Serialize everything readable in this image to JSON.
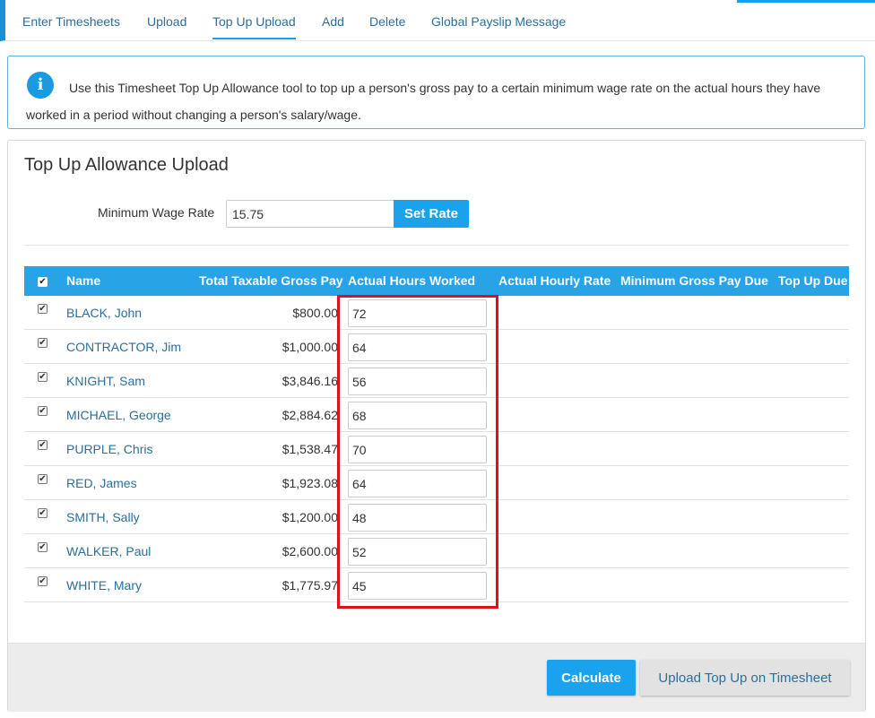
{
  "nav": {
    "tabs": [
      {
        "label": "Enter Timesheets"
      },
      {
        "label": "Upload"
      },
      {
        "label": "Top Up Upload",
        "active": true
      },
      {
        "label": "Add"
      },
      {
        "label": "Delete"
      },
      {
        "label": "Global Payslip Message"
      }
    ]
  },
  "info": {
    "icon": "info-icon",
    "text": "Use this Timesheet Top Up Allowance tool to top up a person's gross pay to a certain minimum wage rate on the actual hours they have worked in a period without changing a person's salary/wage."
  },
  "panel": {
    "title": "Top Up Allowance Upload",
    "min_wage_label": "Minimum Wage Rate",
    "min_wage_value": "15.75",
    "set_rate_label": "Set Rate"
  },
  "table": {
    "headers": {
      "name": "Name",
      "gross": "Total Taxable Gross Pay",
      "hours": "Actual Hours Worked",
      "rate": "Actual Hourly Rate",
      "min_due": "Minimum Gross Pay Due",
      "top_up": "Top Up Due"
    },
    "rows": [
      {
        "name": "BLACK, John",
        "gross": "$800.00",
        "hours": "72",
        "checked": true
      },
      {
        "name": "CONTRACTOR, Jim",
        "gross": "$1,000.00",
        "hours": "64",
        "checked": true
      },
      {
        "name": "KNIGHT, Sam",
        "gross": "$3,846.16",
        "hours": "56",
        "checked": true
      },
      {
        "name": "MICHAEL, George",
        "gross": "$2,884.62",
        "hours": "68",
        "checked": true
      },
      {
        "name": "PURPLE, Chris",
        "gross": "$1,538.47",
        "hours": "70",
        "checked": true
      },
      {
        "name": "RED, James",
        "gross": "$1,923.08",
        "hours": "64",
        "checked": true
      },
      {
        "name": "SMITH, Sally",
        "gross": "$1,200.00",
        "hours": "48",
        "checked": true
      },
      {
        "name": "WALKER, Paul",
        "gross": "$2,600.00",
        "hours": "52",
        "checked": true
      },
      {
        "name": "WHITE, Mary",
        "gross": "$1,775.97",
        "hours": "45",
        "checked": true
      }
    ]
  },
  "footer": {
    "calculate_label": "Calculate",
    "upload_label": "Upload Top Up on Timesheet"
  },
  "colors": {
    "accent": "#1aa3ec",
    "link": "#2a6f9e",
    "highlight": "#e0101a"
  }
}
